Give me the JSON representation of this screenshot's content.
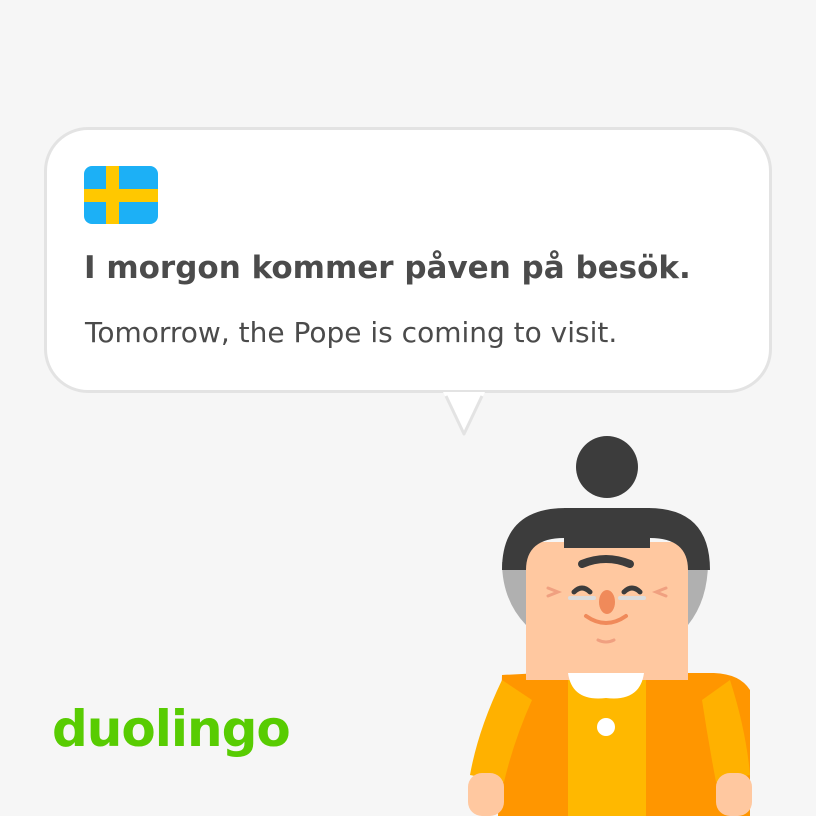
{
  "card": {
    "language_flag": "sweden-flag-icon",
    "sentence": "I morgon kommer påven på besök.",
    "translation": "Tomorrow, the Pope is coming to visit."
  },
  "brand": {
    "logo_text": "duolingo"
  },
  "character": {
    "icon": "grandmother-character-icon"
  },
  "colors": {
    "background": "#f6f6f6",
    "bubble": "#ffffff",
    "bubble_border": "#e3e3e3",
    "text": "#4b4b4b",
    "brand_green": "#58cc02",
    "flag_blue": "#1cb0f6",
    "flag_yellow": "#ffc800",
    "cardigan": "#ff9600"
  }
}
